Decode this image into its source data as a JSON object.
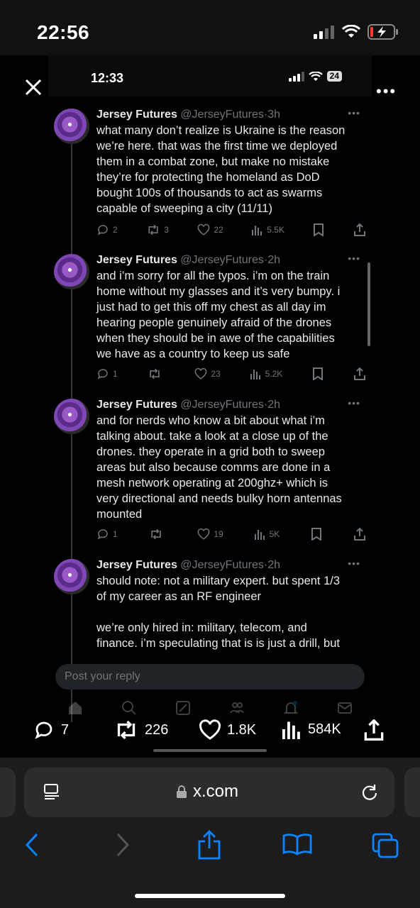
{
  "outer_status": {
    "time": "22:56"
  },
  "inner_status": {
    "time": "12:33",
    "battery": "24"
  },
  "tweets": [
    {
      "name": "Jersey Futures",
      "handle": "@JerseyFutures",
      "age": "3h",
      "text": "what many don’t realize is Ukraine is the reason\nwe’re here. that was the first time we deployed\nthem in a combat zone, but make no mistake\nthey’re for protecting the homeland as DoD\nbought 100s of thousands to act as swarms\ncapable of sweeping a city (11/11)",
      "replies": "2",
      "reposts": "3",
      "likes": "22",
      "views": "5.5K"
    },
    {
      "name": "Jersey Futures",
      "handle": "@JerseyFutures",
      "age": "2h",
      "text": "and i’m sorry for all the typos. i’m on the train\nhome without my glasses and it’s very bumpy. i\njust had to get this off my chest as all day im\nhearing people genuinely afraid of the drones\nwhen they should be in awe of the capabilities\nwe have as a country to keep us safe",
      "replies": "1",
      "reposts": "",
      "likes": "23",
      "views": "5.2K"
    },
    {
      "name": "Jersey Futures",
      "handle": "@JerseyFutures",
      "age": "2h",
      "text": "and for nerds who know a bit about what i’m\ntalking about. take a look at a close up of the\ndrones. they operate in a grid both to sweep\nareas but also because comms are done in a\nmesh network operating at 200ghz+ which is\nvery directional and needs bulky horn antennas\nmounted",
      "replies": "1",
      "reposts": "",
      "likes": "19",
      "views": "5K"
    },
    {
      "name": "Jersey Futures",
      "handle": "@JerseyFutures",
      "age": "2h",
      "text": "should note: not a military expert. but spent 1/3\nof my career as an RF engineer\n\nwe’re only hired in: military, telecom, and\nfinance. i’m speculating that is is just a drill, but",
      "replies": "",
      "reposts": "",
      "likes": "",
      "views": ""
    }
  ],
  "reply_box": {
    "placeholder": "Post your reply"
  },
  "engagement": {
    "replies": "7",
    "reposts": "226",
    "likes": "1.8K",
    "views": "584K"
  },
  "safari": {
    "url": "x.com"
  },
  "colors": {
    "accent": "#1d9bf0",
    "safari_blue": "#0a84ff",
    "battery_red": "#ff3b30"
  }
}
